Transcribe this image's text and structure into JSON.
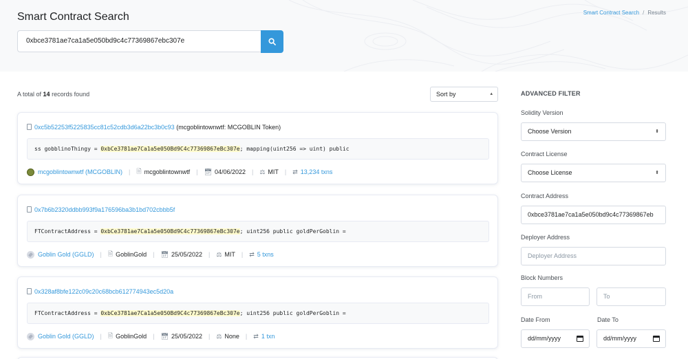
{
  "header": {
    "title": "Smart Contract Search",
    "breadcrumb": {
      "link": "Smart Contract Search",
      "current": "Results"
    },
    "search_value": "0xbce3781ae7ca1a5e050bd9c4c77369867ebc307e"
  },
  "results": {
    "count_prefix": "A total of",
    "count": "14",
    "count_suffix": "records found",
    "sort_label": "Sort by"
  },
  "cards": [
    {
      "address": "0xc5b52253f5225835cc81c52cdb3d6a22bc3b0c93",
      "name": "(mcgoblintownwtf: MCGOBLIN Token)",
      "code_pre": "ss gobblinoThingy = ",
      "code_hl": "0xbCe3781ae7Ca1a5e050Bd9C4c77369867eBc307e",
      "code_post": "; mapping(uint256 => uint) public",
      "token": "mcgoblintownwtf (MCGOBLIN)",
      "contract": "mcgoblintownwtf",
      "date": "04/06/2022",
      "license": "MIT",
      "txns": "13,234 txns"
    },
    {
      "address": "0x7b6b2320ddbb993f9a176596ba3b1bd702cbbb5f",
      "name": "",
      "code_pre": "FTContractAddress = ",
      "code_hl": "0xbCe3781ae7Ca1a5e050Bd9C4c77369867eBc307e",
      "code_post": "; uint256 public goldPerGoblin =",
      "token": "Goblin Gold (GGLD)",
      "contract": "GoblinGold",
      "date": "25/05/2022",
      "license": "MIT",
      "txns": "5 txns"
    },
    {
      "address": "0x328af8bfe122c09c20c68bcb612774943ec5d20a",
      "name": "",
      "code_pre": "FTContractAddress = ",
      "code_hl": "0xbCe3781ae7Ca1a5e050Bd9C4c77369867eBc307e",
      "code_post": "; uint256 public goldPerGoblin =",
      "token": "Goblin Gold (GGLD)",
      "contract": "GoblinGold",
      "date": "25/05/2022",
      "license": "None",
      "txns": "1 txn"
    }
  ],
  "filter": {
    "title": "ADVANCED FILTER",
    "solidity_label": "Solidity Version",
    "solidity_value": "Choose Version",
    "license_label": "Contract License",
    "license_value": "Choose License",
    "address_label": "Contract Address",
    "address_value": "0xbce3781ae7ca1a5e050bd9c4c77369867eb",
    "deployer_label": "Deployer Address",
    "deployer_placeholder": "Deployer Address",
    "block_label": "Block Numbers",
    "block_from_placeholder": "From",
    "block_to_placeholder": "To",
    "date_from_label": "Date From",
    "date_to_label": "Date To",
    "date_placeholder": "dd/mm/yyyy"
  }
}
